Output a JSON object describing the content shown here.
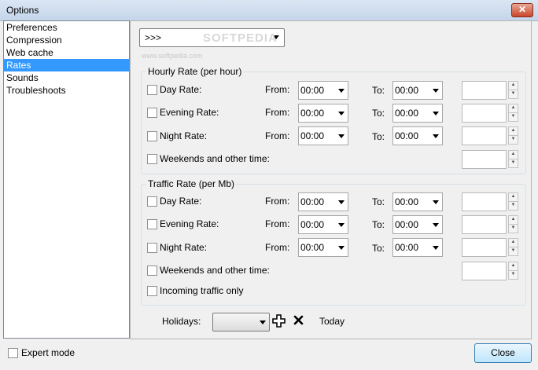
{
  "window": {
    "title": "Options",
    "close_glyph": "✕"
  },
  "sidebar": {
    "items": [
      {
        "label": "Preferences"
      },
      {
        "label": "Compression"
      },
      {
        "label": "Web cache"
      },
      {
        "label": "Rates",
        "selected": true
      },
      {
        "label": "Sounds"
      },
      {
        "label": "Troubleshoots"
      }
    ]
  },
  "profile": {
    "value": ">>>"
  },
  "watermark": {
    "main": "SOFTPEDIA",
    "sub": "www.softpedia.com"
  },
  "hourly": {
    "legend": "Hourly Rate (per hour)",
    "rows": [
      {
        "label": "Day Rate:",
        "from_label": "From:",
        "from": "00:00",
        "to_label": "To:",
        "to": "00:00"
      },
      {
        "label": "Evening Rate:",
        "from_label": "From:",
        "from": "00:00",
        "to_label": "To:",
        "to": "00:00"
      },
      {
        "label": "Night Rate:",
        "from_label": "From:",
        "from": "00:00",
        "to_label": "To:",
        "to": "00:00"
      }
    ],
    "weekends": "Weekends and other time:"
  },
  "traffic": {
    "legend": "Traffic Rate (per Mb)",
    "rows": [
      {
        "label": "Day Rate:",
        "from_label": "From:",
        "from": "00:00",
        "to_label": "To:",
        "to": "00:00"
      },
      {
        "label": "Evening Rate:",
        "from_label": "From:",
        "from": "00:00",
        "to_label": "To:",
        "to": "00:00"
      },
      {
        "label": "Night Rate:",
        "from_label": "From:",
        "from": "00:00",
        "to_label": "To:",
        "to": "00:00"
      }
    ],
    "weekends": "Weekends and other time:",
    "incoming": "Incoming traffic only"
  },
  "holidays": {
    "label": "Holidays:",
    "value": "",
    "add_icon": "plus-outline-icon",
    "remove_icon": "x-icon",
    "today": "Today"
  },
  "footer": {
    "expert_mode": "Expert mode",
    "close": "Close"
  }
}
